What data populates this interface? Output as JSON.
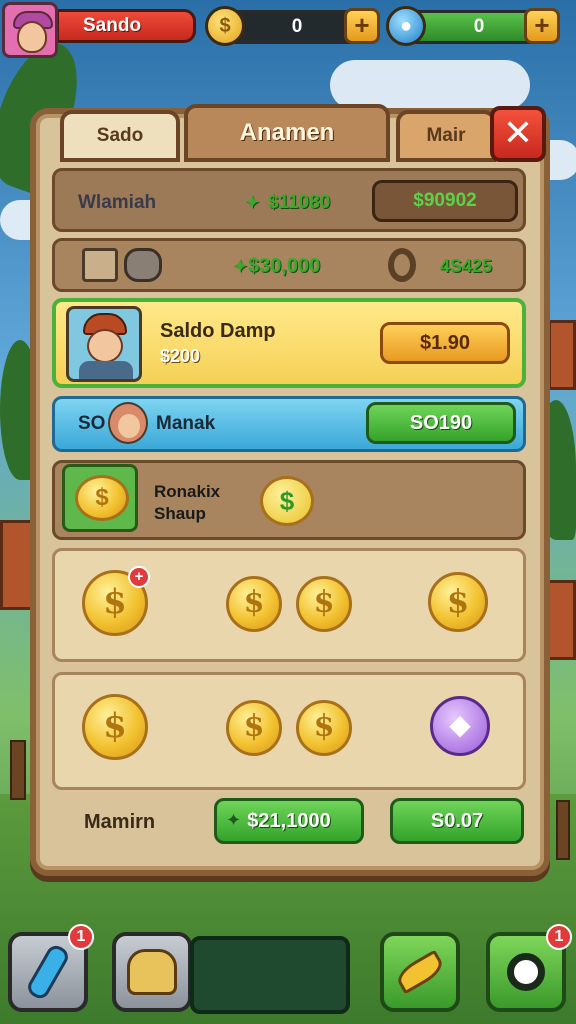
{
  "hud": {
    "player_name": "Sando",
    "coins": "0",
    "gems": "0",
    "icons": [
      "avatar",
      "coin-icon",
      "plus-icon",
      "drop-icon",
      "plus-icon"
    ]
  },
  "tabs": {
    "left": "Sado",
    "center": "Anamen",
    "right": "Mair"
  },
  "close_label": "✕",
  "rows": {
    "row1": {
      "label": "Wlamiah",
      "value": "$11080",
      "button": "$90902"
    },
    "row2": {
      "value": "$30,000",
      "right_value": "4S425"
    },
    "row3": {
      "title": "Saldo Damp",
      "subtitle": "$200",
      "button": "$1.90"
    },
    "row4": {
      "prefix": "SO",
      "name": "Manak",
      "button": "SO190"
    },
    "row5": {
      "line1": "Ronakix",
      "line2": "Shaup"
    }
  },
  "footer": {
    "label": "Mamirn",
    "button1": "$21,1000",
    "button2": "S0.07"
  },
  "badges": {
    "left_count": "1",
    "right_count": "1"
  },
  "colors": {
    "panel": "#d9c39a",
    "accent_green": "#3aa82a",
    "accent_red": "#e23a3a",
    "gold": "#f2c230"
  }
}
